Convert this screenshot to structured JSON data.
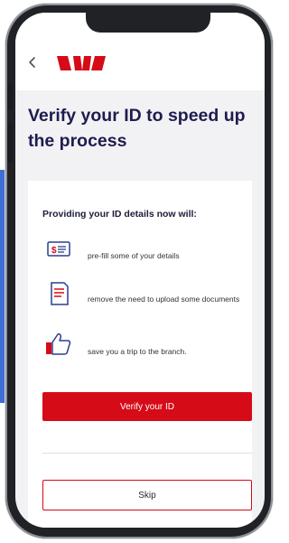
{
  "colors": {
    "brand_red": "#d50b17",
    "title_navy": "#1f1c4f",
    "screen_bg": "#f2f2f4",
    "side_accent_blue": "#3f6fd6"
  },
  "header": {
    "back_icon": "chevron-left-icon",
    "logo": "westpac-logo"
  },
  "page": {
    "title": "Verify your ID to speed up the process"
  },
  "card": {
    "heading": "Providing your ID details now will:",
    "benefits": [
      {
        "icon": "dollar-card-icon",
        "text": "pre-fill some of your details"
      },
      {
        "icon": "document-icon",
        "text": "remove the need to upload some documents"
      },
      {
        "icon": "thumbs-up-icon",
        "text": "save you a trip to the branch."
      }
    ],
    "primary_button": "Verify your ID",
    "secondary_button": "Skip"
  }
}
